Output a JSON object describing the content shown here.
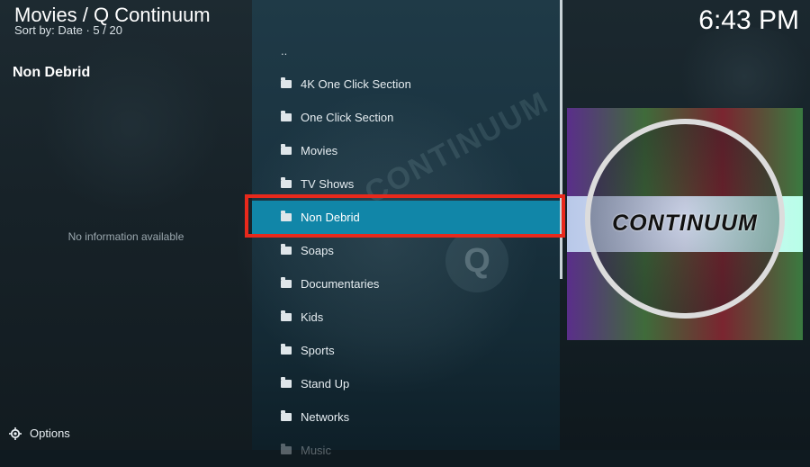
{
  "header": {
    "title": "Movies / Q Continuum",
    "subtitle": "Sort by: Date  ·  5 / 20",
    "clock": "6:43 PM"
  },
  "left_panel": {
    "title": "Non Debrid",
    "info": "No information available"
  },
  "list": {
    "parent": "..",
    "items": [
      {
        "label": "4K One Click Section",
        "icon": "folder-icon"
      },
      {
        "label": "One Click Section",
        "icon": "folder-icon"
      },
      {
        "label": "Movies",
        "icon": "folder-icon"
      },
      {
        "label": "TV Shows",
        "icon": "folder-icon"
      },
      {
        "label": "Non Debrid",
        "icon": "folder-icon",
        "selected": true
      },
      {
        "label": "Soaps",
        "icon": "folder-icon"
      },
      {
        "label": "Documentaries",
        "icon": "folder-icon"
      },
      {
        "label": "Kids",
        "icon": "folder-icon"
      },
      {
        "label": "Sports",
        "icon": "folder-icon"
      },
      {
        "label": "Stand Up",
        "icon": "folder-icon"
      },
      {
        "label": "Networks",
        "icon": "folder-icon"
      },
      {
        "label": "Music",
        "icon": "folder-icon"
      }
    ]
  },
  "artwork": {
    "text": "CONTINUUM"
  },
  "watermark": {
    "text": "CONTINUUM",
    "letter": "Q"
  },
  "footer": {
    "options_label": "Options",
    "icon": "gear-icon"
  },
  "colors": {
    "selected_bg": "#1186a8",
    "highlight_border": "#e8291c"
  }
}
